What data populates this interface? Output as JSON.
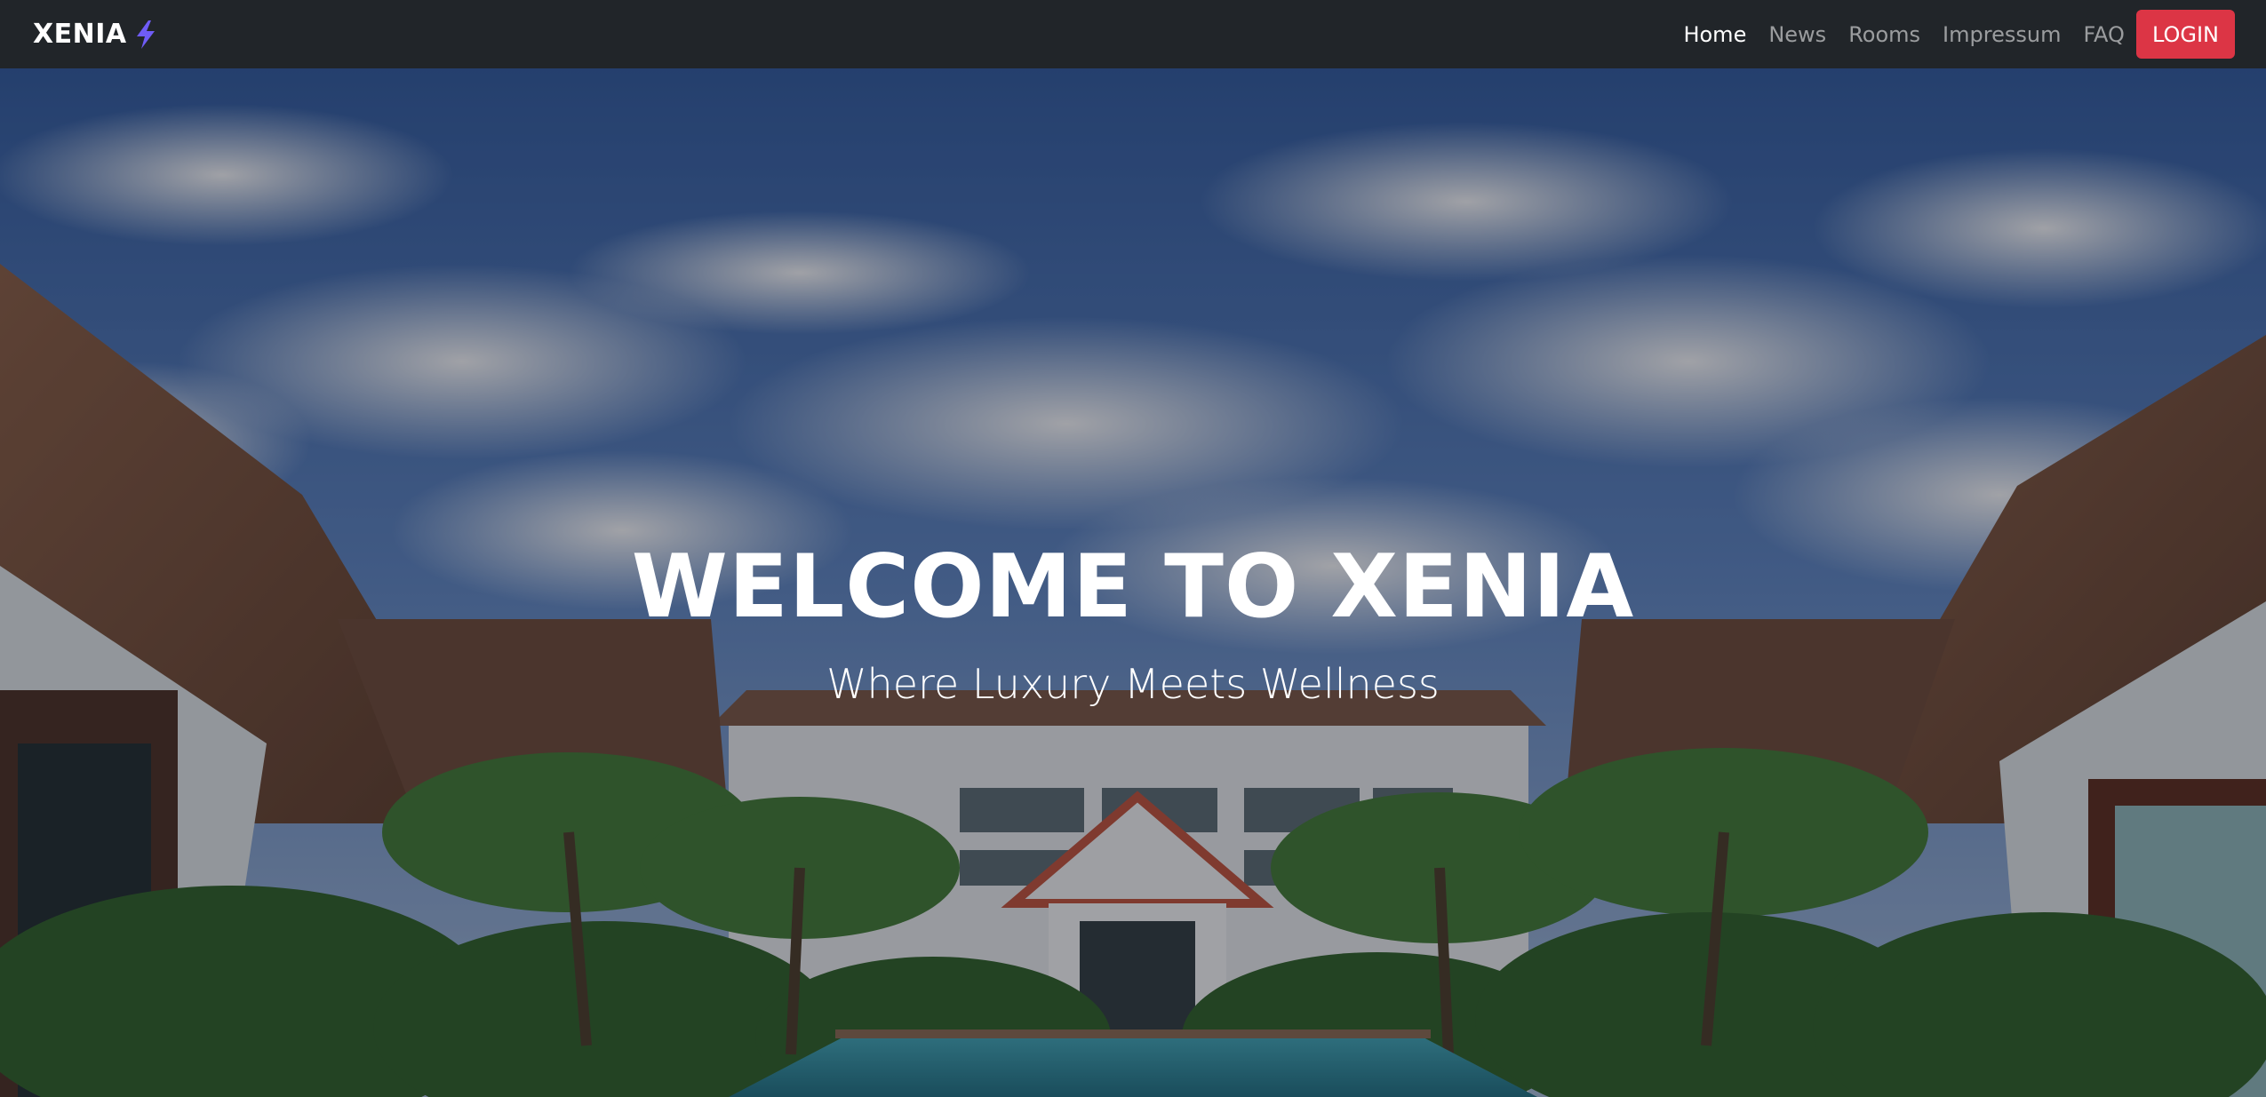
{
  "navbar": {
    "brand": "XENIA",
    "brand_icon": "lightning-bolt-icon",
    "links": [
      {
        "label": "Home",
        "active": true
      },
      {
        "label": "News",
        "active": false
      },
      {
        "label": "Rooms",
        "active": false
      },
      {
        "label": "Impressum",
        "active": false
      },
      {
        "label": "FAQ",
        "active": false
      }
    ],
    "login_label": "LOGIN"
  },
  "hero": {
    "title": "WELCOME TO XENIA",
    "subtitle": "Where Luxury Meets Wellness",
    "image": "resort-pool-with-palm-trees-photo"
  },
  "colors": {
    "navbar_bg": "#212529",
    "login_button": "#dc3545",
    "bolt_accent": "#6f5cf6"
  }
}
